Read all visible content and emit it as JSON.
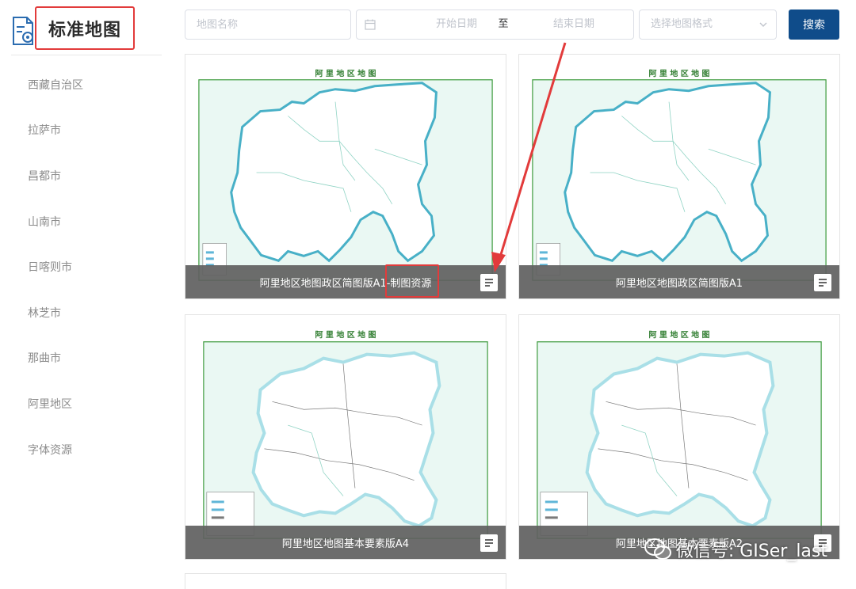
{
  "sidebar": {
    "title": "标准地图",
    "items": [
      {
        "label": "西藏自治区"
      },
      {
        "label": "拉萨市"
      },
      {
        "label": "昌都市"
      },
      {
        "label": "山南市"
      },
      {
        "label": "日喀则市"
      },
      {
        "label": "林芝市"
      },
      {
        "label": "那曲市"
      },
      {
        "label": "阿里地区"
      },
      {
        "label": "字体资源"
      }
    ]
  },
  "search": {
    "name_placeholder": "地图名称",
    "start_date_placeholder": "开始日期",
    "date_separator": "至",
    "end_date_placeholder": "结束日期",
    "format_placeholder": "选择地图格式",
    "button_label": "搜索"
  },
  "cards": [
    {
      "caption": "阿里地区地图政区简图版A1-制图资源",
      "map_title": "阿 里 地 区 地 图"
    },
    {
      "caption": "阿里地区地图政区简图版A1",
      "map_title": "阿 里 地 区 地 图"
    },
    {
      "caption": "阿里地区地图基本要素版A4",
      "map_title": "阿 里 地 区 地 图"
    },
    {
      "caption": "阿里地区地图基本要素版A2",
      "map_title": "阿 里 地 区 地 图"
    }
  ],
  "watermark": {
    "text": "微信号: GISer_last"
  },
  "colors": {
    "accent": "#0f4c8a",
    "annotation": "#e23b3b",
    "map_bg": "#e9f7f2",
    "map_border": "#3c9a3c"
  }
}
